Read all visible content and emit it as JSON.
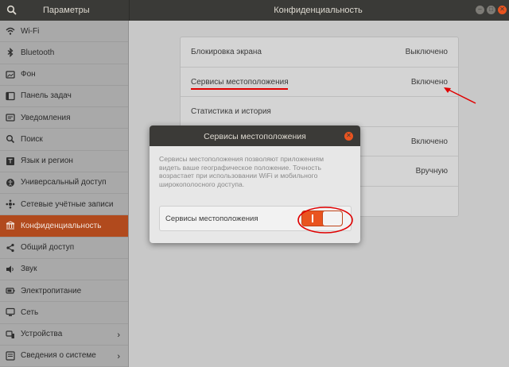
{
  "header": {
    "app_title": "Параметры",
    "page_title": "Конфиденциальность"
  },
  "sidebar": {
    "items": [
      {
        "label": "Wi-Fi",
        "icon": "wifi-icon"
      },
      {
        "label": "Bluetooth",
        "icon": "bluetooth-icon"
      },
      {
        "label": "Фон",
        "icon": "background-icon"
      },
      {
        "label": "Панель задач",
        "icon": "dock-icon"
      },
      {
        "label": "Уведомления",
        "icon": "notifications-icon"
      },
      {
        "label": "Поиск",
        "icon": "search-icon"
      },
      {
        "label": "Язык и регион",
        "icon": "language-icon"
      },
      {
        "label": "Универсальный доступ",
        "icon": "accessibility-icon"
      },
      {
        "label": "Сетевые учётные записи",
        "icon": "online-accounts-icon"
      },
      {
        "label": "Конфиденциальность",
        "icon": "privacy-icon",
        "active": true
      },
      {
        "label": "Общий доступ",
        "icon": "share-icon"
      },
      {
        "label": "Звук",
        "icon": "sound-icon"
      },
      {
        "label": "Электропитание",
        "icon": "power-icon"
      },
      {
        "label": "Сеть",
        "icon": "network-icon"
      },
      {
        "label": "Устройства",
        "icon": "devices-icon",
        "chevron": true
      },
      {
        "label": "Сведения о системе",
        "icon": "info-icon",
        "chevron": true
      }
    ]
  },
  "privacy_list": {
    "rows": [
      {
        "label": "Блокировка экрана",
        "value": "Выключено"
      },
      {
        "label": "Сервисы местоположения",
        "value": "Включено"
      },
      {
        "label": "Статистика и история",
        "value": ""
      },
      {
        "label": "",
        "value": "Включено"
      },
      {
        "label": "",
        "value": "Вручную"
      },
      {
        "label": "",
        "value": ""
      }
    ]
  },
  "dialog": {
    "title": "Сервисы местоположения",
    "description": "Сервисы местоположения позволяют приложениям видеть ваше географическое положение. Точность возрастает при использовании WiFi и мобильного широкополосного доступа.",
    "switch_label": "Сервисы местоположения",
    "switch_on": true
  },
  "colors": {
    "accent": "#e95420",
    "active_item": "#b14a1d",
    "annotation": "#e00000"
  }
}
